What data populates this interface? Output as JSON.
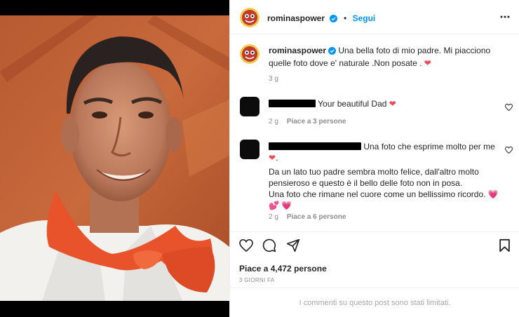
{
  "post": {
    "author": "rominaspower",
    "follow_label": "Segui",
    "dot": "•"
  },
  "caption": {
    "author": "rominaspower",
    "text": "Una bella foto di mio padre. Mi piacciono quelle foto dove e' naturale .Non posate .",
    "time": "3 g"
  },
  "comments": [
    {
      "text": "Your beautiful Dad",
      "time": "2 g",
      "likes": "Piace a 3 persone"
    },
    {
      "text_first": "Una foto che esprime molto per me",
      "lines": [
        "Da un lato tuo padre sembra molto felice, dall'altro molto",
        "pensieroso e questo è il bello delle foto non in posa.",
        "Una foto che rimane nel cuore come un bellissimo ricordo."
      ],
      "time": "2 g",
      "likes": "Piace a 6 persone"
    }
  ],
  "footer": {
    "likes": "Piace a 4,472 persone",
    "date": "3 GIORNI FA",
    "limited": "I commenti su questo post sono stati limitati."
  },
  "icons": {
    "verified": "verified-badge-icon",
    "heart": "heart-icon",
    "comment": "comment-icon",
    "share": "share-icon",
    "save": "bookmark-icon",
    "more": "more-options-icon"
  },
  "colors": {
    "accent": "#0095f6",
    "heart_red": "#ed4956",
    "muted": "#8e8e8e"
  }
}
